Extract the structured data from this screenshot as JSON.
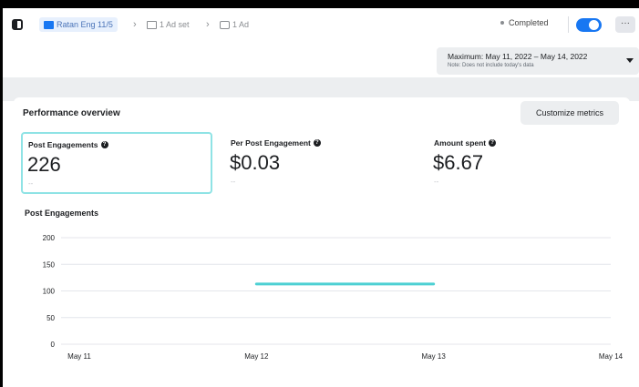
{
  "breadcrumb": {
    "campaign": "Ratan Eng 11/5",
    "adset": "1 Ad set",
    "ad": "1 Ad"
  },
  "status": {
    "label": "Completed",
    "toggle_on": true
  },
  "more_label": "···",
  "date": {
    "range": "Maximum: May 11, 2022 – May 14, 2022",
    "note": "Note: Does not include today's data"
  },
  "performance": {
    "title": "Performance overview",
    "customize_label": "Customize metrics"
  },
  "metrics": [
    {
      "label": "Post Engagements",
      "value": "226",
      "sub": "--"
    },
    {
      "label": "Per Post Engagement",
      "value": "$0.03",
      "sub": "--"
    },
    {
      "label": "Amount spent",
      "value": "$6.67",
      "sub": "--"
    }
  ],
  "chart_data": {
    "type": "line",
    "title": "Post Engagements",
    "x": [
      "May 11",
      "May 12",
      "May 13",
      "May 14"
    ],
    "yticks": [
      "200",
      "150",
      "100",
      "50",
      "0"
    ],
    "ylim": [
      0,
      200
    ],
    "series": [
      {
        "values": [
          null,
          113,
          113,
          null
        ],
        "color": "#4dd0d3"
      }
    ],
    "grid": true
  },
  "colors": {
    "accent": "#1877f2",
    "selected_border": "#8fe3e5",
    "line": "#4dd0d3"
  }
}
